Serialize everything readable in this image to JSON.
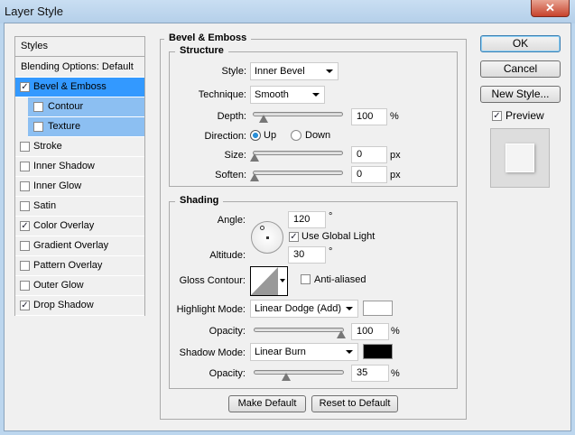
{
  "window": {
    "title": "Layer Style",
    "close": "✕"
  },
  "styles_list": {
    "header": "Styles",
    "blending": "Blending Options: Default",
    "items": [
      {
        "label": "Bevel & Emboss",
        "checked": true,
        "selected": true
      },
      {
        "label": "Contour",
        "checked": false,
        "sub": true
      },
      {
        "label": "Texture",
        "checked": false,
        "sub": true
      },
      {
        "label": "Stroke",
        "checked": false
      },
      {
        "label": "Inner Shadow",
        "checked": false
      },
      {
        "label": "Inner Glow",
        "checked": false
      },
      {
        "label": "Satin",
        "checked": false
      },
      {
        "label": "Color Overlay",
        "checked": true
      },
      {
        "label": "Gradient Overlay",
        "checked": false
      },
      {
        "label": "Pattern Overlay",
        "checked": false
      },
      {
        "label": "Outer Glow",
        "checked": false
      },
      {
        "label": "Drop Shadow",
        "checked": true
      }
    ]
  },
  "bevel": {
    "title": "Bevel & Emboss",
    "structure": {
      "title": "Structure",
      "style_label": "Style:",
      "style": "Inner Bevel",
      "technique_label": "Technique:",
      "technique": "Smooth",
      "depth_label": "Depth:",
      "depth": "100",
      "depth_pct": 0.1,
      "pct": "%",
      "direction_label": "Direction:",
      "up": "Up",
      "down": "Down",
      "size_label": "Size:",
      "size": "0",
      "px": "px",
      "soften_label": "Soften:",
      "soften": "0"
    },
    "shading": {
      "title": "Shading",
      "angle_label": "Angle:",
      "angle": "120",
      "deg": "°",
      "global_light": "Use Global Light",
      "altitude_label": "Altitude:",
      "altitude": "30",
      "gloss_label": "Gloss Contour:",
      "anti_aliased": "Anti-aliased",
      "highlight_label": "Highlight Mode:",
      "highlight_mode": "Linear Dodge (Add)",
      "highlight_color": "#ffffff",
      "opacity_label": "Opacity:",
      "highlight_opacity": "100",
      "shadow_label": "Shadow Mode:",
      "shadow_mode": "Linear Burn",
      "shadow_color": "#000000",
      "shadow_opacity": "35"
    },
    "make_default": "Make Default",
    "reset_default": "Reset to Default"
  },
  "buttons": {
    "ok": "OK",
    "cancel": "Cancel",
    "new_style": "New Style...",
    "preview": "Preview"
  }
}
